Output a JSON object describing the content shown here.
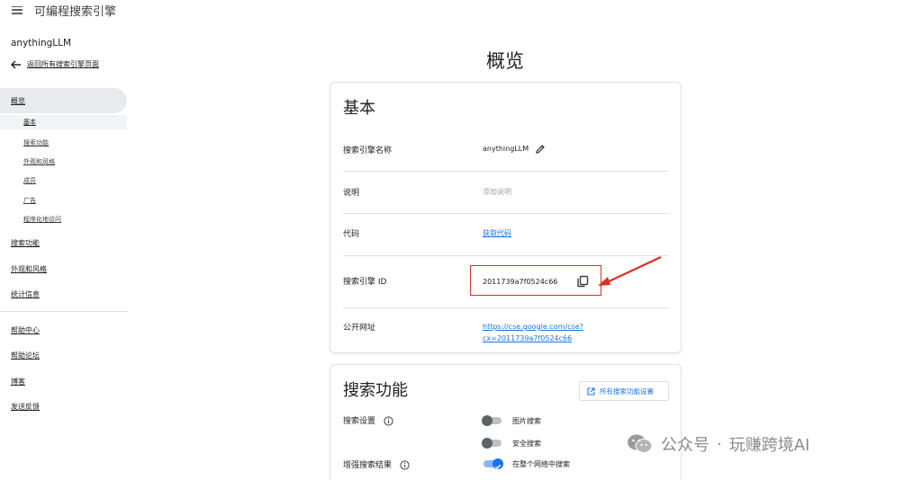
{
  "topbar": {
    "title": "可编程搜索引擎"
  },
  "sidebar": {
    "engine_name": "anythingLLM",
    "back_label": "返回所有搜索引擎页面",
    "overview": "概览",
    "sub_items": [
      "基本",
      "搜索功能",
      "外观和风格",
      "成员",
      "广告",
      "程序化地访问"
    ],
    "main_items": [
      "搜索功能",
      "外观和风格",
      "统计信息"
    ],
    "help_items": [
      "帮助中心",
      "帮助论坛",
      "博客",
      "发送反馈"
    ]
  },
  "main": {
    "page_title": "概览",
    "basic": {
      "title": "基本",
      "rows": {
        "name_label": "搜索引擎名称",
        "name_value": "anythingLLM",
        "desc_label": "说明",
        "desc_value": "添加说明",
        "code_label": "代码",
        "code_value": "获取代码",
        "id_label": "搜索引擎 ID",
        "id_value": "2011739a7f0524c66",
        "url_label": "公开网址",
        "url_line1": "https://cse.google.com/cse?",
        "url_line2": "cx=2011739a7f0524c66"
      }
    },
    "features": {
      "title": "搜索功能",
      "all_settings_button": "所有搜索功能设置",
      "search_settings_label": "搜索设置",
      "enhanced_results_label": "增强搜索结果",
      "toggles": [
        {
          "label": "图片搜索",
          "on": false
        },
        {
          "label": "安全搜索",
          "on": false
        },
        {
          "label": "在整个网络中搜索",
          "on": true
        }
      ]
    }
  },
  "watermark": {
    "left": "公众号",
    "dot": "·",
    "right": "玩赚跨境AI"
  },
  "colors": {
    "accent": "#1a73e8",
    "annotation": "#d93025",
    "selected_bg": "#e8eaed"
  }
}
